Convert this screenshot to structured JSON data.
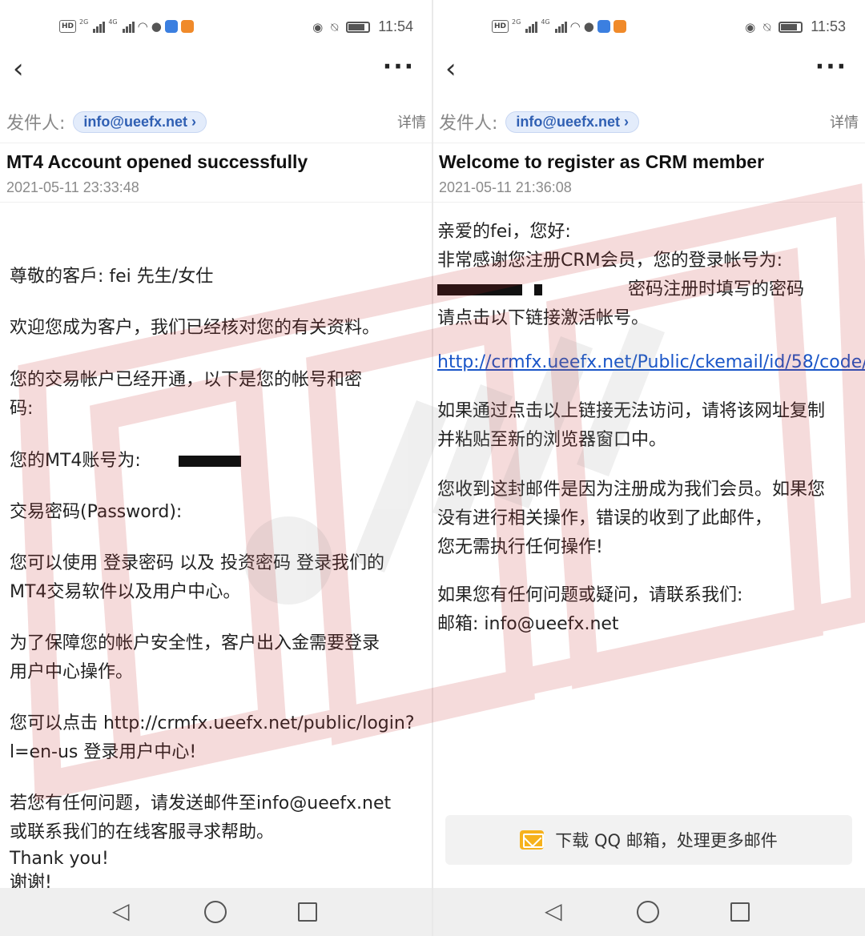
{
  "left": {
    "status": {
      "time": "11:54",
      "hd": "HD",
      "sig1": "2G",
      "sig2": "4G"
    },
    "sender_label": "发件人:",
    "sender_email": "info@ueefx.net",
    "details_label": "详情",
    "subject": "MT4 Account opened successfully",
    "date": "2021-05-11 23:33:48",
    "body": {
      "p1": "尊敬的客戶:   fei 先生/女仕",
      "p2": "欢迎您成为客户，我们已经核对您的有关资料。",
      "p3a": "您的交易帐户已经开通，以下是您的帐号和密",
      "p3b": "码:",
      "p4": "您的MT4账号为:",
      "p5": "交易密码(Password):",
      "p6a": "您可以使用 登录密码  以及 投资密码  登录我们的",
      "p6b": "MT4交易软件以及用户中心。",
      "p7a": "为了保障您的帐户安全性，客户出入金需要登录",
      "p7b": "用户中心操作。",
      "p8a": "您可以点击 http://crmfx.ueefx.net/public/login?",
      "p8b": "l=en-us 登录用户中心!",
      "p9a": "若您有任何问题，请发送邮件至info@ueefx.net",
      "p9b": "或联系我们的在线客服寻求帮助。",
      "p10": "Thank you!",
      "p11": "谢谢!"
    }
  },
  "right": {
    "status": {
      "time": "11:53",
      "hd": "HD",
      "sig1": "2G",
      "sig2": "4G"
    },
    "sender_label": "发件人:",
    "sender_email": "info@ueefx.net",
    "details_label": "详情",
    "subject": "Welcome to register as CRM member",
    "date": "2021-05-11 21:36:08",
    "body": {
      "l1": "亲爱的fei，您好:",
      "l2": "非常感谢您注册CRM会员，您的登录帐号为:",
      "l3": "密码注册时填写的密码",
      "l4": "请点击以下链接激活帐号。",
      "link": "http://crmfx.ueefx.net/Public/ckemail/id/58/code/",
      "l5a": "如果通过点击以上链接无法访问，请将该网址复制",
      "l5b": "并粘贴至新的浏览器窗口中。",
      "l6a": "您收到这封邮件是因为注册成为我们会员。如果您",
      "l6b": "没有进行相关操作，错误的收到了此邮件，",
      "l6c": "您无需执行任何操作!",
      "l7a": "如果您有任何问题或疑问，请联系我们:",
      "l7b": "邮箱:  info@ueefx.net"
    },
    "download_banner": "下载 QQ 邮箱，处理更多邮件"
  },
  "colors": {
    "link": "#1a56c8",
    "chip_bg": "#e3ecfb",
    "chip_text": "#2f5fb3",
    "watermark": "#c62828"
  },
  "icons": [
    "back-chevron-icon",
    "more-dots-icon",
    "nav-back-icon",
    "nav-home-icon",
    "nav-recent-icon",
    "qq-mail-icon"
  ]
}
